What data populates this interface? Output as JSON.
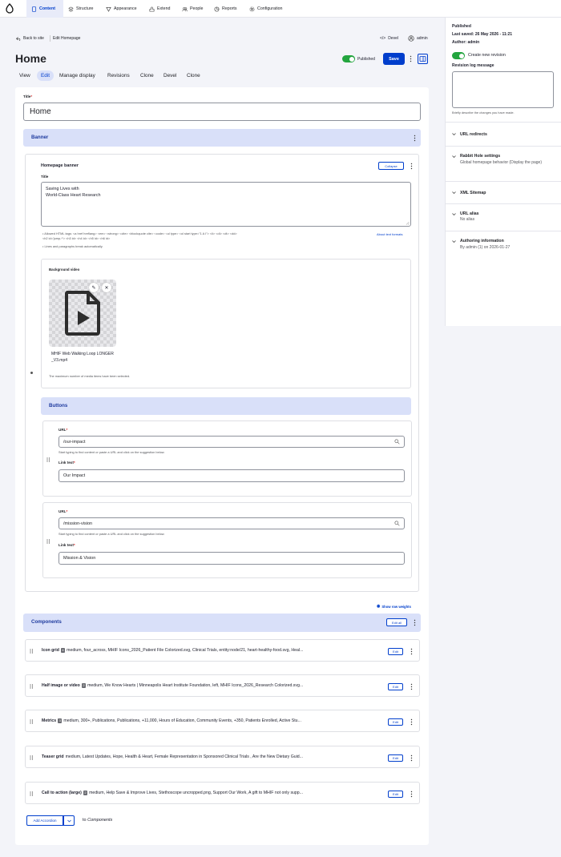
{
  "toolbar": {
    "items": [
      "Content",
      "Structure",
      "Appearance",
      "Extend",
      "People",
      "Reports",
      "Configuration"
    ]
  },
  "header": {
    "back_to_site": "Back to site",
    "breadcrumb": "Edit Homepage",
    "devel": "Devel",
    "user": "admin",
    "title": "Home",
    "published_label": "Published",
    "save_label": "Save"
  },
  "tabs": [
    "View",
    "Edit",
    "Manage display",
    "Revisions",
    "Clone",
    "Devel",
    "Clone"
  ],
  "form": {
    "title_label": "Title",
    "title_value": "Home",
    "banner": {
      "heading": "Banner",
      "paragraph_title": "Homepage banner",
      "collapse_label": "Collapse",
      "field_title_label": "Title",
      "field_title_value": "Saving Lives with\nWorld-Class Heart Research",
      "allowed_tags": "Allowed HTML tags: <a href hreflang> <em> <strong> <cite> <blockquote cite> <code> <ul type> <ol start type=\"1 A I\"> <li> <dl> <dt> <dd> <h2 id='jump-*'> <h3 id> <h4 id> <h5 id> <h6 id>",
      "line_breaks": "Lines and paragraphs break automatically.",
      "about_formats": "About text formats",
      "bg_video_label": "Background video",
      "media_filename": "MHIF Web Walking Loop LONGER_V3.mp4",
      "media_note": "The maximum number of media items have been selected.",
      "buttons_heading": "Buttons",
      "buttons": [
        {
          "url_label": "URL",
          "url_value": "/our-impact",
          "url_help": "Start typing to find content or paste a URL and click on the suggestion below.",
          "link_label": "Link text",
          "link_value": "Our Impact"
        },
        {
          "url_label": "URL",
          "url_value": "/mission-vision",
          "url_help": "Start typing to find content or paste a URL and click on the suggestion below.",
          "link_label": "Link text",
          "link_value": "Mission & Vision"
        }
      ]
    },
    "show_row_weights": "Show row weights",
    "components": {
      "heading": "Components",
      "edit_all": "Edit all",
      "edit_label": "Edit",
      "items": [
        {
          "name": "Icon grid",
          "badge": "4",
          "summary": "medium, four_across, MHIF Icons_2026_Patient File Colorized.svg, Clinical Trials, entity:node/21, heart-healthy-food.svg, Heal..."
        },
        {
          "name": "Half image or video",
          "badge": "2",
          "summary": "medium, We Know Hearts  |  Minneapolis Heart Institute Foundation, left, MHIF Icons_2026_Research Colorized.svg..."
        },
        {
          "name": "Metrics",
          "badge": "3",
          "summary": "medium, 300+, Publications, Publications, +11,000, Hours of Education, Community Events, +350, Patients Enrolled, Active Stu..."
        },
        {
          "name": "Teaser grid",
          "badge": "",
          "summary": "medium, Latest Updates, Hope, Health & Heart, Female Representation in Sponsored Clinical Trials , Are the New Dietary Guid..."
        },
        {
          "name": "Call to action (large)",
          "badge": "2",
          "summary": "medium, Help Save & Improve Lives, Stethoscope uncropped.png, Support Our Work, A gift to MHIF not only supp..."
        }
      ],
      "add_label": "Add Accordion",
      "to_text": "to",
      "to_target": "Components"
    }
  },
  "sidebar": {
    "status": "Published",
    "last_saved": "Last saved: 26 May 2026 - 11:21",
    "author": "Author: admin",
    "create_revision": "Create new revision",
    "revision_log_label": "Revision log message",
    "revision_log_value": "",
    "revision_help": "Briefly describe the changes you have made.",
    "sections": [
      {
        "title": "URL redirects",
        "sub": ""
      },
      {
        "title": "Rabbit Hole settings",
        "sub": "Global homepage behavior (Display the page)"
      },
      {
        "title": "XML Sitemap",
        "sub": ""
      },
      {
        "title": "URL alias",
        "sub": "No alias"
      },
      {
        "title": "Authoring information",
        "sub": "By admin (1) on 2026-01-27"
      }
    ]
  },
  "colors": {
    "accent": "#003ecc",
    "band": "#d9e0f9",
    "toggle": "#23a53f"
  }
}
